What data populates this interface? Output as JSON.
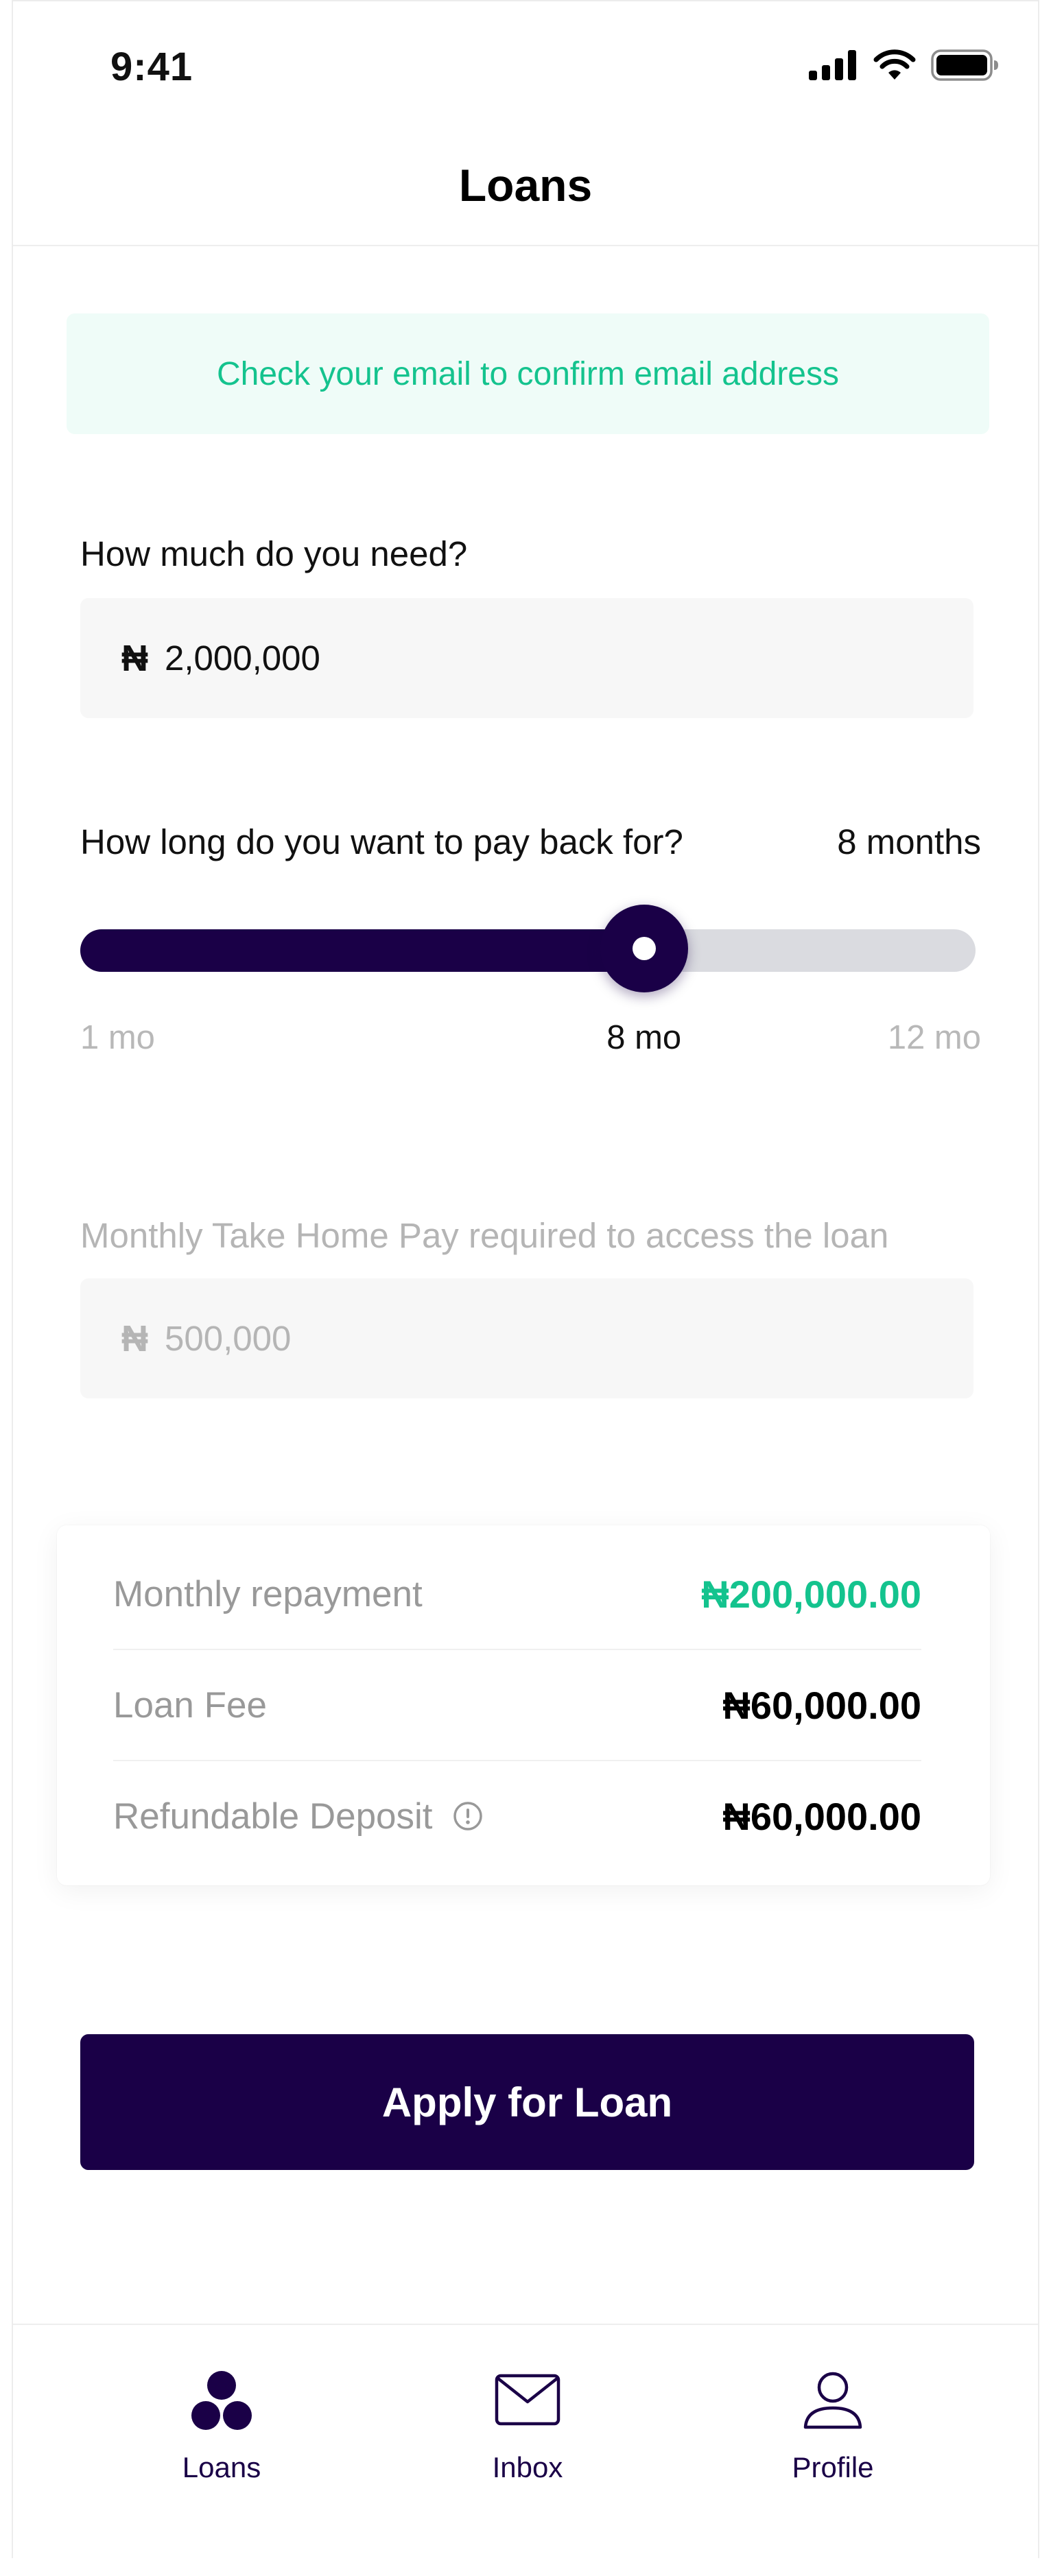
{
  "status_bar": {
    "time": "9:41",
    "icons": [
      "signal-icon",
      "wifi-icon",
      "battery-icon"
    ]
  },
  "header": {
    "title": "Loans"
  },
  "banner": {
    "text": "Check your email to confirm email address",
    "color": "#14c38e",
    "background": "#effcf8"
  },
  "amount": {
    "label": "How much do you need?",
    "currency": "₦",
    "value": "2,000,000"
  },
  "duration": {
    "label": "How long do you want to pay back for?",
    "value_text": "8 months",
    "min_label": "1 mo",
    "max_label": "12 mo",
    "current_label": "8 mo",
    "min": 1,
    "max": 12,
    "current": 8
  },
  "take_home": {
    "label": "Monthly Take Home Pay required to access the loan",
    "currency": "₦",
    "value": "500,000"
  },
  "summary": {
    "rows": [
      {
        "label": "Monthly repayment",
        "value": "₦200,000.00",
        "accent": true
      },
      {
        "label": "Loan Fee",
        "value": "₦60,000.00",
        "accent": false
      },
      {
        "label": "Refundable Deposit",
        "value": "₦60,000.00",
        "accent": false,
        "icon": "info-icon"
      }
    ]
  },
  "cta": {
    "label": "Apply for Loan"
  },
  "bottom_nav": {
    "items": [
      {
        "label": "Loans",
        "icon": "loans-icon"
      },
      {
        "label": "Inbox",
        "icon": "mail-icon"
      },
      {
        "label": "Profile",
        "icon": "profile-icon"
      }
    ]
  },
  "colors": {
    "primary": "#1a0047",
    "accent": "#14c38e",
    "muted": "#999999",
    "track": "#dadbe0"
  }
}
